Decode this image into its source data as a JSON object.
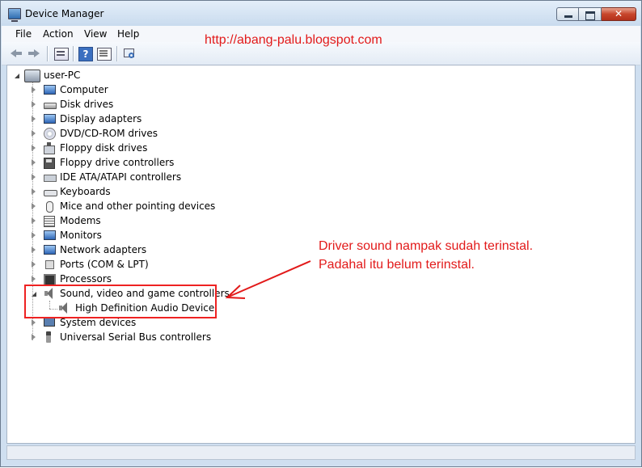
{
  "window": {
    "title": "Device Manager",
    "close_glyph": "✕"
  },
  "menu": [
    "File",
    "Action",
    "View",
    "Help"
  ],
  "watermark": "http://abang-palu.blogspot.com",
  "toolbar": {
    "buttons": [
      "back-icon",
      "forward-icon",
      "view-icon",
      "help-icon",
      "properties-icon",
      "scan-hardware-icon"
    ],
    "help_glyph": "?"
  },
  "tree": {
    "root": "user-PC",
    "items": [
      "Computer",
      "Disk drives",
      "Display adapters",
      "DVD/CD-ROM drives",
      "Floppy disk drives",
      "Floppy drive controllers",
      "IDE ATA/ATAPI controllers",
      "Keyboards",
      "Mice and other pointing devices",
      "Modems",
      "Monitors",
      "Network adapters",
      "Ports (COM & LPT)",
      "Processors",
      "Sound, video and game controllers",
      "System devices",
      "Universal Serial Bus controllers"
    ],
    "expanded_child": "High Definition Audio Device"
  },
  "annotation": {
    "line1": "Driver sound nampak sudah terinstal.",
    "line2": "Padahal itu belum terinstal.",
    "color": "#e21a1a"
  }
}
